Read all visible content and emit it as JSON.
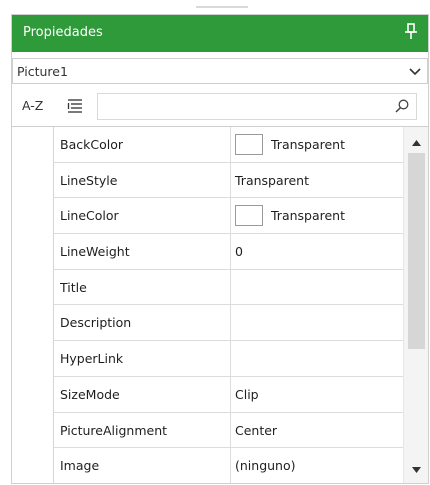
{
  "panel": {
    "title": "Propiedades",
    "pin_icon": "pin-icon"
  },
  "object_selector": {
    "value": "Picture1"
  },
  "toolbar": {
    "sort_alpha_label": "A-Z",
    "categorized_icon": "categorized-list-icon",
    "search_placeholder": "",
    "search_icon": "search-icon"
  },
  "properties": [
    {
      "name": "BackColor",
      "value": "Transparent",
      "swatch": "#ffffff"
    },
    {
      "name": "LineStyle",
      "value": "Transparent"
    },
    {
      "name": "LineColor",
      "value": "Transparent",
      "swatch": "#ffffff"
    },
    {
      "name": "LineWeight",
      "value": "0"
    },
    {
      "name": "Title",
      "value": ""
    },
    {
      "name": "Description",
      "value": ""
    },
    {
      "name": "HyperLink",
      "value": ""
    },
    {
      "name": "SizeMode",
      "value": "Clip"
    },
    {
      "name": "PictureAlignment",
      "value": "Center"
    },
    {
      "name": "Image",
      "value": "(ninguno)"
    }
  ],
  "colors": {
    "titlebar": "#2e9a39"
  }
}
